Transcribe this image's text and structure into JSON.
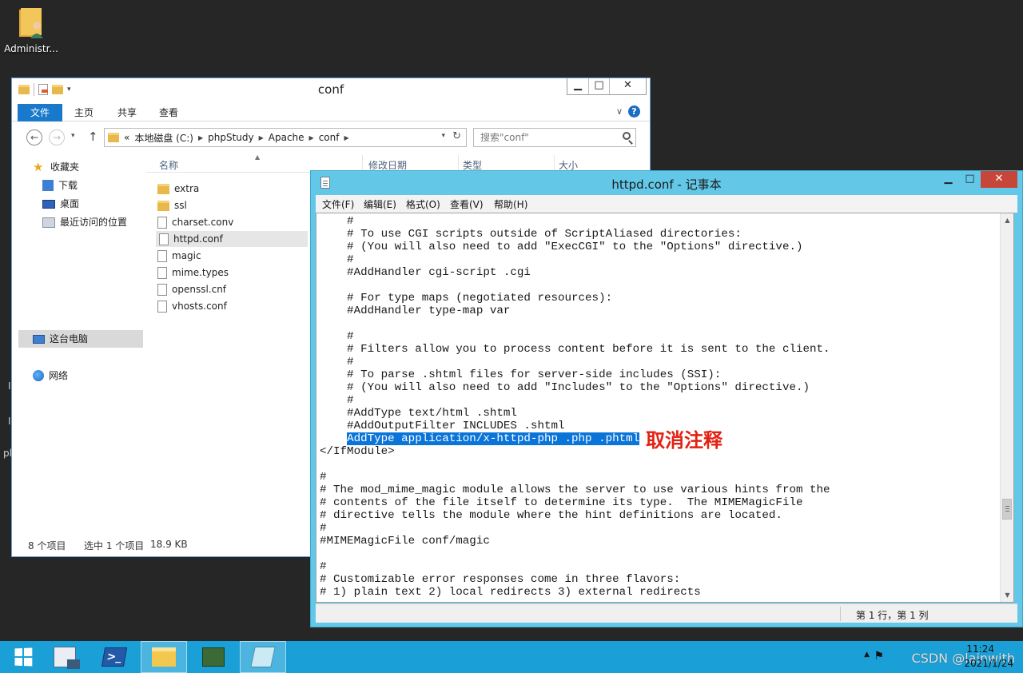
{
  "desktop": {
    "icon_label": "Administr...",
    "edge_chars": [
      "I",
      "I",
      "pl"
    ]
  },
  "explorer": {
    "title": "conf",
    "ribbon_tabs": [
      "文件",
      "主页",
      "共享",
      "查看"
    ],
    "breadcrumb": [
      "本地磁盘 (C:)",
      "phpStudy",
      "Apache",
      "conf"
    ],
    "breadcrumb_prefix": "«",
    "search_placeholder": "搜索\"conf\"",
    "columns": [
      "名称",
      "修改日期",
      "类型",
      "大小"
    ],
    "nav_items": [
      {
        "label": "收藏夹",
        "icon": "star-icon"
      },
      {
        "label": "下载",
        "icon": "download-folder-icon"
      },
      {
        "label": "桌面",
        "icon": "desktop-icon"
      },
      {
        "label": "最近访问的位置",
        "icon": "recent-places-icon"
      },
      {
        "label": "这台电脑",
        "icon": "computer-icon"
      },
      {
        "label": "网络",
        "icon": "network-icon"
      }
    ],
    "files": [
      {
        "name": "extra",
        "kind": "folder"
      },
      {
        "name": "ssl",
        "kind": "folder"
      },
      {
        "name": "charset.conv",
        "kind": "file"
      },
      {
        "name": "httpd.conf",
        "kind": "file"
      },
      {
        "name": "magic",
        "kind": "file"
      },
      {
        "name": "mime.types",
        "kind": "file"
      },
      {
        "name": "openssl.cnf",
        "kind": "file"
      },
      {
        "name": "vhosts.conf",
        "kind": "file"
      }
    ],
    "selected_file": "httpd.conf",
    "status": {
      "count": "8 个项目",
      "selection": "选中 1 个项目",
      "size": "18.9 KB"
    }
  },
  "notepad": {
    "title": "httpd.conf - 记事本",
    "menu": [
      "文件(F)",
      "编辑(E)",
      "格式(O)",
      "查看(V)",
      "帮助(H)"
    ],
    "lines": [
      "    #",
      "    # To use CGI scripts outside of ScriptAliased directories:",
      "    # (You will also need to add \"ExecCGI\" to the \"Options\" directive.)",
      "    #",
      "    #AddHandler cgi-script .cgi",
      "",
      "    # For type maps (negotiated resources):",
      "    #AddHandler type-map var",
      "",
      "    #",
      "    # Filters allow you to process content before it is sent to the client.",
      "    #",
      "    # To parse .shtml files for server-side includes (SSI):",
      "    # (You will also need to add \"Includes\" to the \"Options\" directive.)",
      "    #",
      "    #AddType text/html .shtml",
      "    #AddOutputFilter INCLUDES .shtml",
      "AddType application/x-httpd-php .php .phtml",
      "</IfModule>",
      "",
      "#",
      "# The mod_mime_magic module allows the server to use various hints from the",
      "# contents of the file itself to determine its type.  The MIMEMagicFile",
      "# directive tells the module where the hint definitions are located.",
      "#",
      "#MIMEMagicFile conf/magic",
      "",
      "#",
      "# Customizable error responses come in three flavors:",
      "# 1) plain text 2) local redirects 3) external redirects"
    ],
    "highlight_line_index": 17,
    "highlight_indent": "    ",
    "annotation": "取消注释",
    "status_position": "第 1 行，第 1 列"
  },
  "taskbar": {
    "time": "11:24",
    "date": "2021/1/24",
    "watermark": "CSDN @lainwith",
    "apps": [
      "start",
      "server-manager",
      "powershell",
      "file-explorer",
      "computer-management",
      "notepad"
    ]
  },
  "colors": {
    "taskbar": "#1aa0d7",
    "notepad_frame": "#63c8e8",
    "selection_highlight": "#0a74d8",
    "annotation_red": "#e32012",
    "ribbon_file_tab": "#1979ca"
  }
}
